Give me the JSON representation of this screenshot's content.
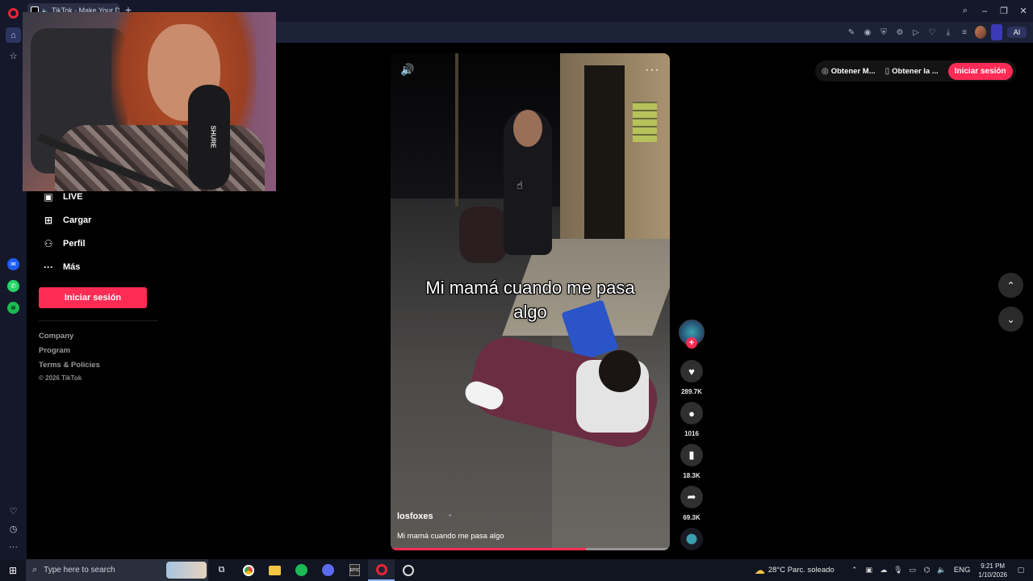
{
  "browser": {
    "tab_title": "TikTok - Make Your D...",
    "new_tab_symbol": "+",
    "ai_button": "AI"
  },
  "tiktok": {
    "nav": [
      {
        "label": "LIVE",
        "icon": "live-icon"
      },
      {
        "label": "Cargar",
        "icon": "upload-icon"
      },
      {
        "label": "Perfil",
        "icon": "profile-icon"
      },
      {
        "label": "Más",
        "icon": "more-icon"
      }
    ],
    "login_button": "Iniciar sesión",
    "footer": [
      "Company",
      "Program",
      "Terms & Policies"
    ],
    "copyright": "© 2026 TikTok",
    "top_right": {
      "get_app_1": "Obtener M...",
      "get_app_2": "Obtener la ...",
      "login": "Iniciar sesión"
    }
  },
  "video": {
    "caption_overlay": "Mi mamá cuando me pasa algo",
    "author": "losfoxes",
    "description": "Mi mamá cuando me pasa algo",
    "progress": 0.7,
    "likes": "289.7K",
    "comments": "1016",
    "saves": "18.3K",
    "shares": "69.3K"
  },
  "webcam": {
    "mic_label": "SHURE"
  },
  "taskbar": {
    "search_placeholder": "Type here to search",
    "weather": "28°C  Parc. soleado",
    "language": "ENG",
    "time": "9:21 PM",
    "date": "1/10/2026"
  }
}
